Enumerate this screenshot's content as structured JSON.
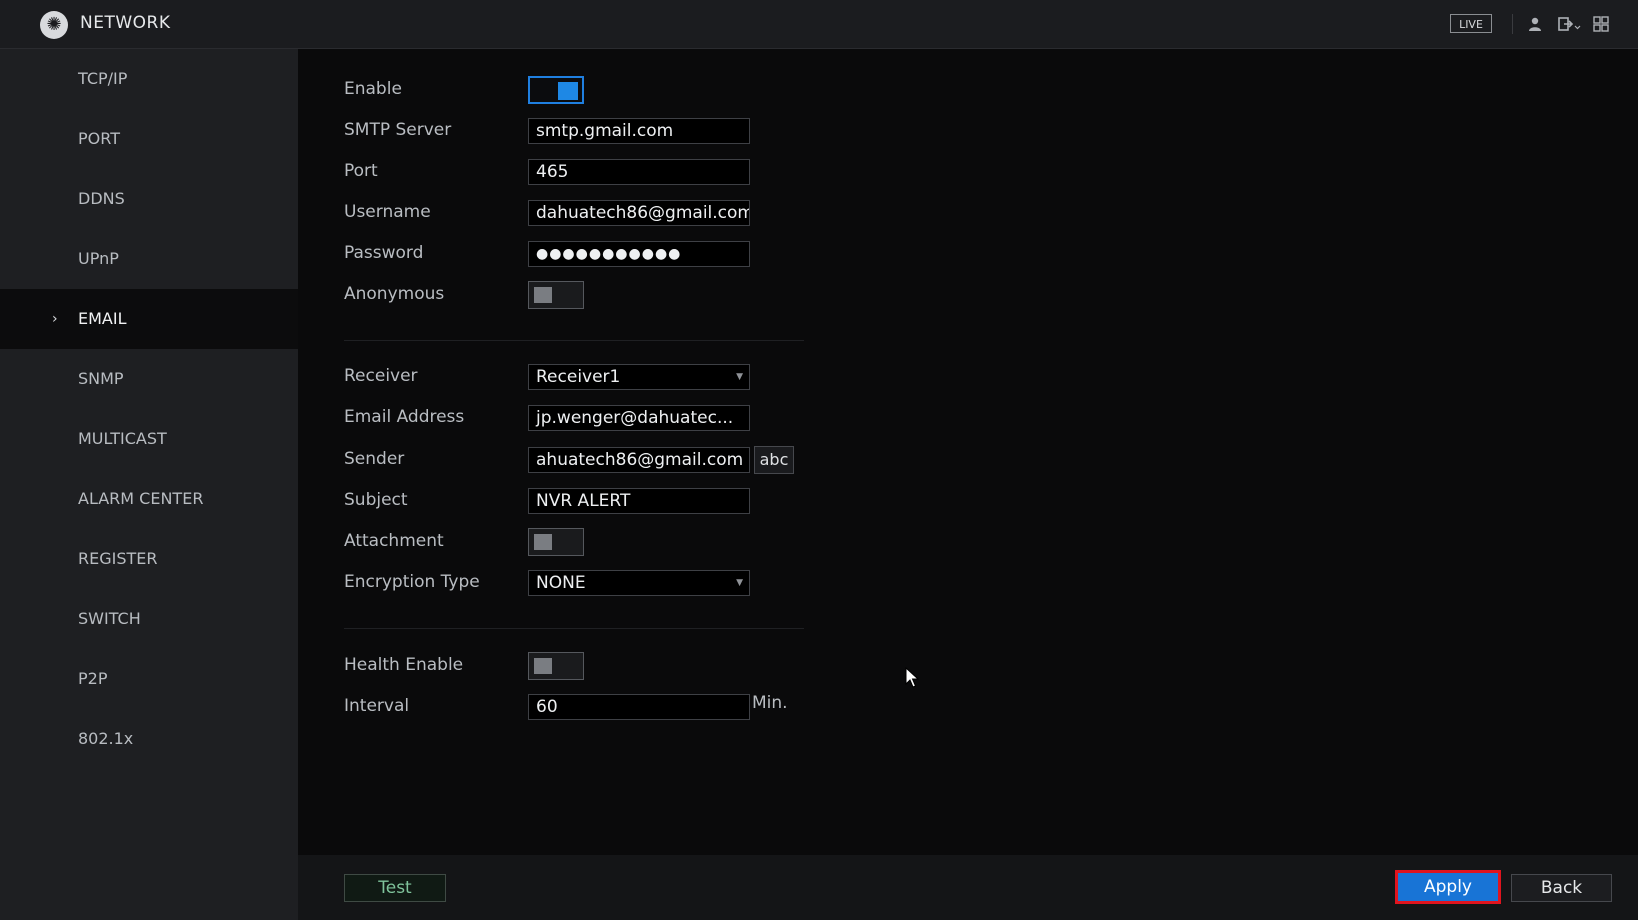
{
  "header": {
    "title": "NETWORK",
    "live_label": "LIVE",
    "icons": [
      "network-logo-icon",
      "user-icon",
      "logout-icon",
      "grid-menu-icon"
    ]
  },
  "sidebar": {
    "items": [
      {
        "label": "TCP/IP",
        "active": false
      },
      {
        "label": "PORT",
        "active": false
      },
      {
        "label": "DDNS",
        "active": false
      },
      {
        "label": "UPnP",
        "active": false
      },
      {
        "label": "EMAIL",
        "active": true
      },
      {
        "label": "SNMP",
        "active": false
      },
      {
        "label": "MULTICAST",
        "active": false
      },
      {
        "label": "ALARM CENTER",
        "active": false
      },
      {
        "label": "REGISTER",
        "active": false
      },
      {
        "label": "SWITCH",
        "active": false
      },
      {
        "label": "P2P",
        "active": false
      },
      {
        "label": "802.1x",
        "active": false
      }
    ]
  },
  "form": {
    "enable": {
      "label": "Enable",
      "on": true
    },
    "smtp_server": {
      "label": "SMTP Server",
      "value": "smtp.gmail.com"
    },
    "port": {
      "label": "Port",
      "value": "465"
    },
    "username": {
      "label": "Username",
      "value": "dahuatech86@gmail.com"
    },
    "password": {
      "label": "Password",
      "value": "●●●●●●●●●●●"
    },
    "anonymous": {
      "label": "Anonymous",
      "on": false
    },
    "receiver": {
      "label": "Receiver",
      "value": "Receiver1"
    },
    "email_address": {
      "label": "Email Address",
      "value": "jp.wenger@dahuatec..."
    },
    "sender": {
      "label": "Sender",
      "value": "ahuatech86@gmail.com",
      "keyboard_label": "abc"
    },
    "subject": {
      "label": "Subject",
      "value": "NVR ALERT"
    },
    "attachment": {
      "label": "Attachment",
      "on": false
    },
    "encryption_type": {
      "label": "Encryption Type",
      "value": "NONE"
    },
    "health_enable": {
      "label": "Health Enable",
      "on": false
    },
    "interval": {
      "label": "Interval",
      "value": "60",
      "unit": "Min."
    }
  },
  "footer": {
    "test_label": "Test",
    "apply_label": "Apply",
    "back_label": "Back"
  },
  "colors": {
    "accent": "#1e88e5",
    "highlight_border": "#e0141e",
    "test_text": "#7fc39b"
  }
}
